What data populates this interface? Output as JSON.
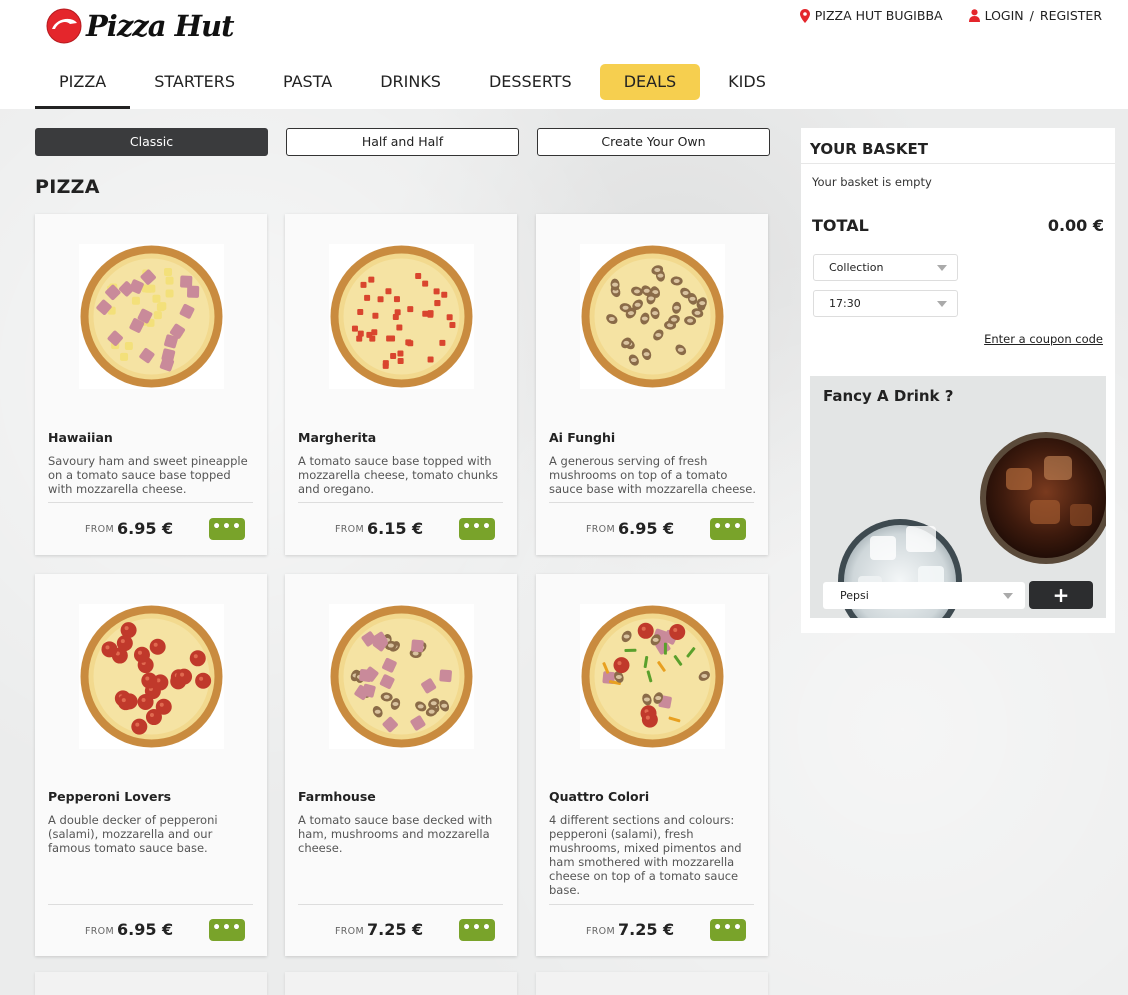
{
  "header": {
    "logo_text": "Pizza Hut",
    "store": "PIZZA HUT BUGIBBA",
    "login": "LOGIN",
    "separator": "/",
    "register": "REGISTER"
  },
  "nav": {
    "items": [
      {
        "label": "PIZZA",
        "active": true
      },
      {
        "label": "STARTERS"
      },
      {
        "label": "PASTA"
      },
      {
        "label": "DRINKS"
      },
      {
        "label": "DESSERTS"
      },
      {
        "label": "DEALS",
        "highlight": "#f6cf4f"
      },
      {
        "label": "KIDS"
      }
    ]
  },
  "subtabs": [
    "Classic",
    "Half and Half",
    "Create Your Own"
  ],
  "section_title": "PIZZA",
  "products": [
    {
      "name": "Hawaiian",
      "desc": "Savoury ham and sweet pineapple on a tomato sauce base topped with mozzarella cheese.",
      "from": "FROM",
      "price": "6.95 €",
      "more": "•••",
      "topping": "ham-pineapple"
    },
    {
      "name": "Margherita",
      "desc": "A tomato sauce base topped with mozzarella cheese, tomato chunks and oregano.",
      "from": "FROM",
      "price": "6.15 €",
      "more": "•••",
      "topping": "tomato"
    },
    {
      "name": "Ai Funghi",
      "desc": "A generous serving of fresh mushrooms on top of a tomato sauce base with mozzarella cheese.",
      "from": "FROM",
      "price": "6.95 €",
      "more": "•••",
      "topping": "mushroom"
    },
    {
      "name": "Pepperoni Lovers",
      "desc": "A double decker of pepperoni (salami), mozzarella and our famous tomato sauce base.",
      "from": "FROM",
      "price": "6.95 €",
      "more": "•••",
      "topping": "pepperoni"
    },
    {
      "name": "Farmhouse",
      "desc": "A tomato sauce base decked with ham, mushrooms and mozzarella cheese.",
      "from": "FROM",
      "price": "7.25 €",
      "more": "•••",
      "topping": "ham-mushroom"
    },
    {
      "name": "Quattro Colori",
      "desc": "4 different sections and colours: pepperoni (salami), fresh mushrooms, mixed pimentos and ham smothered with mozzarella cheese on top of a tomato sauce base.",
      "from": "FROM",
      "price": "7.25 €",
      "more": "•••",
      "topping": "quattro"
    }
  ],
  "basket": {
    "title": "YOUR BASKET",
    "empty_text": "Your basket is empty",
    "total_label": "TOTAL",
    "total_value": "0.00 €",
    "collection": "Collection",
    "time": "17:30",
    "coupon": "Enter a coupon code",
    "drink_title": "Fancy A Drink ?",
    "drink_selected": "Pepsi",
    "add_label": "+"
  },
  "colors": {
    "accent_green": "#79a32a",
    "deals_yellow": "#f6cf4f",
    "brand_red": "#e4262c",
    "dark": "#3a3b3d"
  }
}
